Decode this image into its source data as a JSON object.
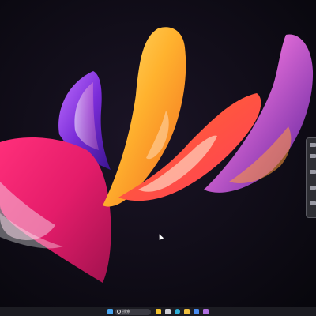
{
  "desktop": {
    "wallpaper_name": "abstract-bloom-wallpaper",
    "background_color": "#0c0a14"
  },
  "taskbar": {
    "background_color": "#1c1c22",
    "search": {
      "placeholder": "搜索",
      "icon": "search-icon"
    },
    "icons": [
      {
        "name": "start-icon",
        "color": "#4aa6f0"
      },
      {
        "name": "search-button-icon",
        "color": "#9ab0c8"
      },
      {
        "name": "widgets-icon",
        "color": "#f2c230"
      },
      {
        "name": "task-view-icon",
        "color": "#cfcfd6"
      },
      {
        "name": "edge-icon",
        "color": "#2fb0d8"
      },
      {
        "name": "file-explorer-icon",
        "color": "#f0c040"
      },
      {
        "name": "store-icon",
        "color": "#4a8cf0"
      },
      {
        "name": "app-icon",
        "color": "#b070e0"
      }
    ]
  },
  "side_panel": {
    "name": "side-panel"
  }
}
